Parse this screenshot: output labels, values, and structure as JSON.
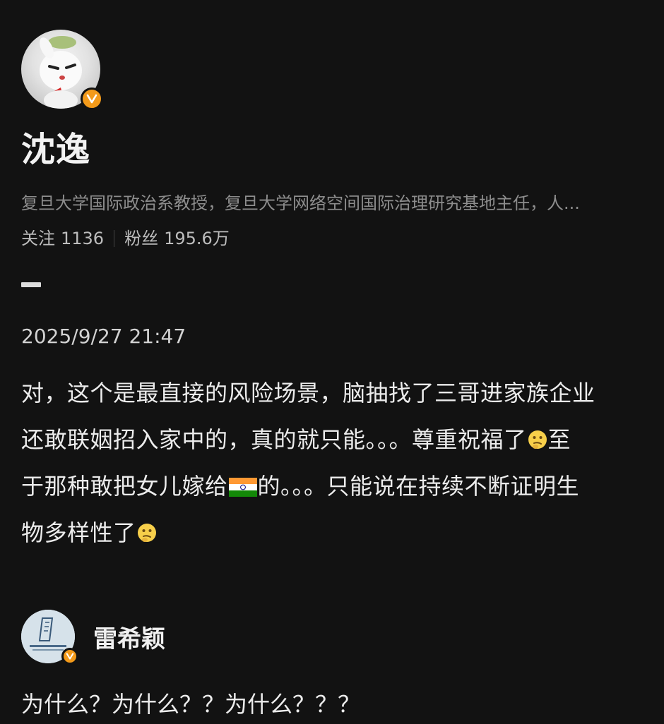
{
  "profile": {
    "name": "沈逸",
    "bio": "复旦大学国际政治系教授，复旦大学网络空间国际治理研究基地主任，人...",
    "following_label": "关注",
    "following_count": "1136",
    "followers_label": "粉丝",
    "followers_count": "195.6万",
    "verified_badge": "V"
  },
  "post": {
    "timestamp": "2025/9/27 21:47",
    "lines": [
      {
        "text": "对，这个是最直接的风险场景，脑抽找了三哥进家族企业"
      },
      {
        "before": "还敢联姻招入家中的，真的就只能。。。尊重祝福了",
        "after": "至"
      },
      {
        "before": "于那种敢把女儿嫁给",
        "after": "的。。。只能说在持续不断证明生"
      },
      {
        "before": "物多样性了",
        "after": ""
      }
    ],
    "emoji": "thinking-face-icon",
    "flag": "india-flag-icon"
  },
  "reply": {
    "name": "雷希颖",
    "text": "为什么？为什么？？为什么？？？",
    "verified_badge": "V"
  },
  "colors": {
    "background": "#121212",
    "badge": "#f39a1a",
    "secondary_text": "#8d8d8d"
  }
}
